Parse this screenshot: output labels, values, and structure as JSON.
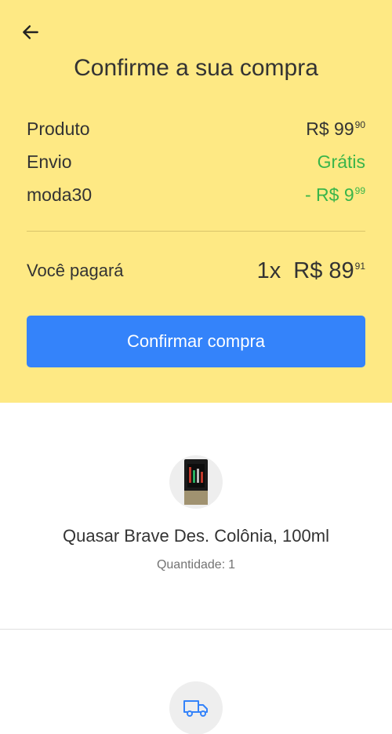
{
  "header": {
    "back_icon": "arrow-left-icon",
    "title": "Confirme a sua compra"
  },
  "summary": {
    "rows": [
      {
        "label": "Produto",
        "value_main": "R$ 99",
        "value_cents": "90"
      },
      {
        "label": "Envio",
        "value_main": "Grátis",
        "value_cents": ""
      },
      {
        "label": "moda30",
        "value_main": "- R$ 9",
        "value_cents": "99"
      }
    ],
    "total_label": "Você pagará",
    "total_quantity": "1x",
    "total_main": "R$ 89",
    "total_cents": "91",
    "confirm_label": "Confirmar compra"
  },
  "product": {
    "name": "Quasar Brave Des. Colônia, 100ml",
    "quantity_label": "Quantidade:",
    "quantity_value": "1"
  },
  "shipping": {
    "icon": "truck-icon"
  },
  "colors": {
    "summary_bg": "#fee984",
    "primary": "#3483fa",
    "success": "#39b54a"
  }
}
